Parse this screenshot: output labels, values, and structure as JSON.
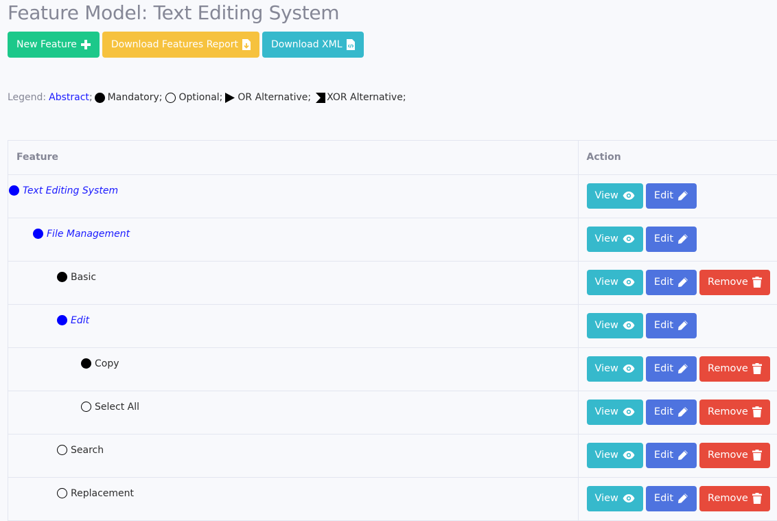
{
  "header": {
    "title": "Feature Model: Text Editing System"
  },
  "toolbar": {
    "new_feature": "New Feature",
    "download_report": "Download Features Report",
    "download_xml": "Download XML"
  },
  "legend": {
    "label": "Legend:",
    "abstract": "Abstract",
    "mandatory": "Mandatory;",
    "optional": "Optional;",
    "or_alt": "OR Alternative;",
    "xor_alt": "XOR Alternative;"
  },
  "table": {
    "headers": [
      "Feature",
      "Action"
    ],
    "actions": {
      "view": "View",
      "edit": "Edit",
      "remove": "Remove"
    },
    "rows": [
      {
        "name": "Text Editing System",
        "type": "abstract",
        "depth": 0
      },
      {
        "name": "File Management",
        "type": "abstract",
        "depth": 1
      },
      {
        "name": "Basic",
        "type": "mandatory",
        "depth": 2
      },
      {
        "name": "Edit",
        "type": "abstract",
        "depth": 2
      },
      {
        "name": "Copy",
        "type": "mandatory",
        "depth": 3
      },
      {
        "name": "Select All",
        "type": "optional",
        "depth": 3
      },
      {
        "name": "Search",
        "type": "optional",
        "depth": 2
      },
      {
        "name": "Replacement",
        "type": "optional",
        "depth": 2
      }
    ]
  },
  "colors": {
    "success": "#1cc88a",
    "warning": "#f6c23e",
    "info": "#36b9cc",
    "primary": "#4e73df",
    "danger": "#e74a3b",
    "abstract": "#0000ff"
  }
}
